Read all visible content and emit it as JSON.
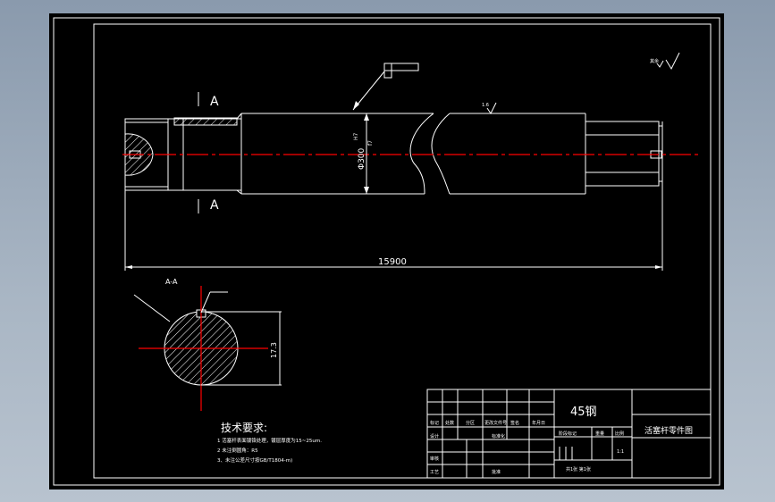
{
  "drawing": {
    "section_label_top": "A",
    "section_label_bottom": "A",
    "section_view_label": "A-A",
    "overall_length": "15900",
    "diameter": "Φ300",
    "diameter_tol_upper": "f7",
    "diameter_tol_fit": "H7",
    "section_width": "17.3",
    "section_width_tol": "-0.2",
    "roughness_top": "1.6",
    "roughness_corner": "其余"
  },
  "tech_requirements": {
    "heading": "技术要求:",
    "items": [
      "1  活塞杆表面镀铬处理，镀层厚度为15~25um.",
      "2  未注倒圆角：R5",
      "3、未注公差尺寸按GB/T1804-m)"
    ]
  },
  "title_block": {
    "material": "45钢",
    "part_name": "活塞杆零件图",
    "row_labels": [
      "标记",
      "处数",
      "分区",
      "更改文件号",
      "签名",
      "年月日"
    ],
    "design": "设计",
    "standardization": "标准化",
    "review": "审核",
    "process": "工艺",
    "approve": "批准",
    "stage_mark": "阶段标记",
    "weight": "重量",
    "scale": "比例",
    "scale_value": "1:1",
    "sheet_info": "共1张  第1张"
  },
  "colors": {
    "centerline": "#ff0000",
    "line": "#ffffff",
    "background": "#000000"
  }
}
